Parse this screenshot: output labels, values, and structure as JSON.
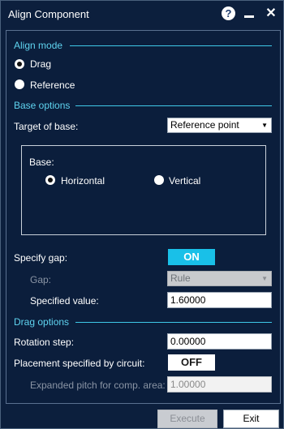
{
  "window": {
    "title": "Align Component"
  },
  "titlebar": {
    "help_glyph": "?",
    "close_glyph": "✕"
  },
  "align_mode": {
    "heading": "Align mode",
    "options": [
      {
        "label": "Drag",
        "selected": true
      },
      {
        "label": "Reference",
        "selected": false
      }
    ]
  },
  "base_options": {
    "heading": "Base options",
    "target_label": "Target of base:",
    "target_value": "Reference point",
    "base_group": {
      "label": "Base:",
      "options": [
        {
          "label": "Horizontal",
          "selected": true
        },
        {
          "label": "Vertical",
          "selected": false
        }
      ]
    },
    "specify_gap_label": "Specify gap:",
    "specify_gap_state": "ON",
    "gap_label": "Gap:",
    "gap_value": "Rule",
    "specified_value_label": "Specified value:",
    "specified_value": "1.60000"
  },
  "drag_options": {
    "heading": "Drag options",
    "rotation_step_label": "Rotation step:",
    "rotation_step_value": "0.00000",
    "placement_label": "Placement specified by circuit:",
    "placement_state": "OFF",
    "expanded_pitch_label": "Expanded pitch for comp. area:",
    "expanded_pitch_value": "1.00000"
  },
  "footer": {
    "execute_label": "Execute",
    "exit_label": "Exit"
  },
  "colors": {
    "background": "#0b1e3c",
    "accent": "#3fc9e8",
    "toggle_on": "#19c0e8"
  }
}
